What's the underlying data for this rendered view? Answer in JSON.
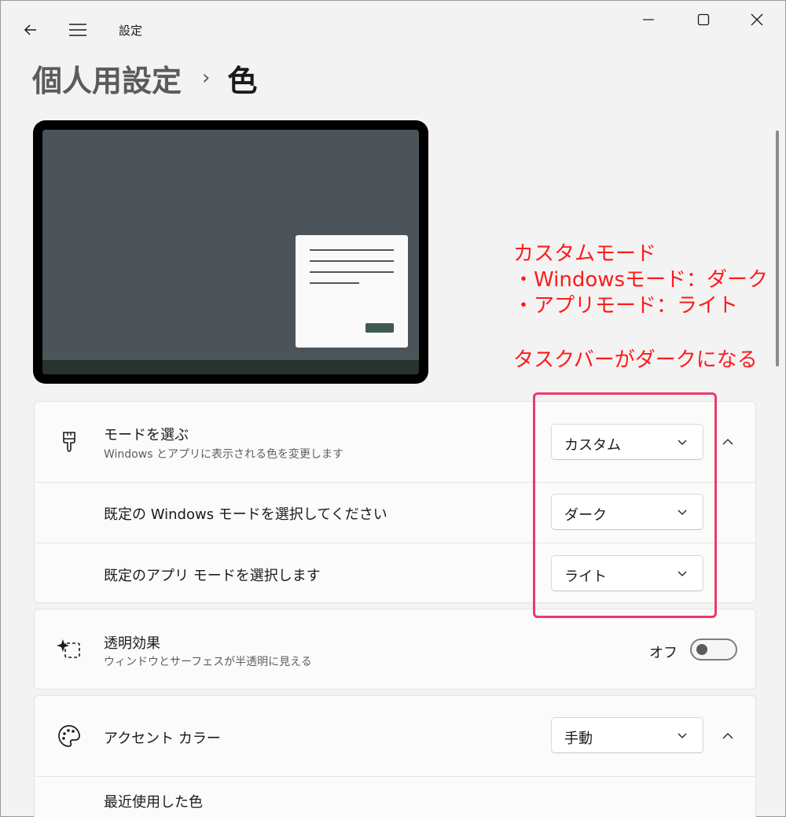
{
  "window": {
    "app_title": "設定"
  },
  "breadcrumb": {
    "parent": "個人用設定",
    "separator": "›",
    "current": "色"
  },
  "annotation": {
    "lines": [
      "カスタムモード",
      "・Windowsモード：ダーク",
      "・アプリモード：ライト"
    ],
    "result": "タスクバーがダークになる",
    "color": "#ff1a1a",
    "box_color": "#ea3a6a"
  },
  "mode_section": {
    "title": "モードを選ぶ",
    "subtitle": "Windows とアプリに表示される色を変更します",
    "icon": "paintbrush-icon",
    "value": "カスタム",
    "expanded": true,
    "windows_mode": {
      "label": "既定の Windows モードを選択してください",
      "value": "ダーク"
    },
    "app_mode": {
      "label": "既定のアプリ モードを選択します",
      "value": "ライト"
    }
  },
  "transparency": {
    "title": "透明効果",
    "subtitle": "ウィンドウとサーフェスが半透明に見える",
    "icon": "sparkle-icon",
    "state_label": "オフ",
    "on": false
  },
  "accent": {
    "title": "アクセント カラー",
    "icon": "palette-icon",
    "value": "手動",
    "expanded": true,
    "recent_colors_label": "最近使用した色"
  },
  "colors": {
    "background": "#f3f3f3",
    "card": "#fbfbfb",
    "preview_desktop": "#4c5459",
    "preview_taskbar": "#26332e"
  }
}
